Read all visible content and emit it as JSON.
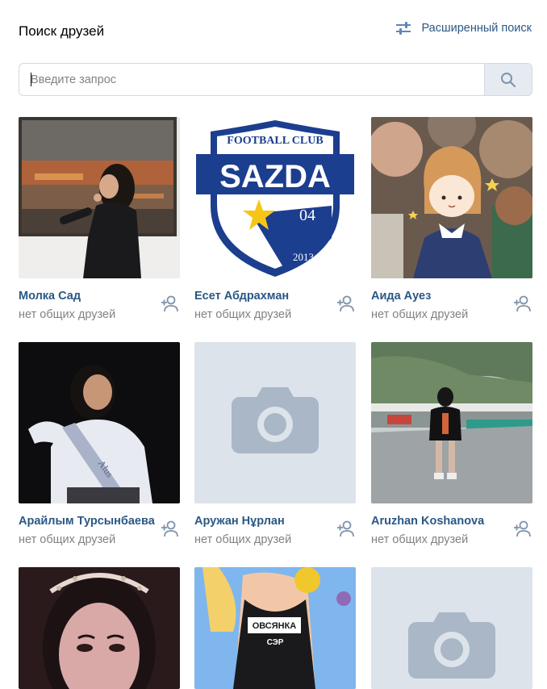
{
  "header": {
    "title": "Поиск друзей",
    "advanced_label": "Расширенный поиск"
  },
  "search": {
    "placeholder": "Введите запрос"
  },
  "people": [
    {
      "name": "Молка Сад",
      "mutual": "нет общих друзей",
      "photo": "girl-gallery-photo"
    },
    {
      "name": "Есет Абдрахман",
      "mutual": "нет общих друзей",
      "photo": "sazda-fc-logo"
    },
    {
      "name": "Аида Ауез",
      "mutual": "нет общих друзей",
      "photo": "cartoon-girl-illustration"
    },
    {
      "name": "Арайлым Турсынбаева",
      "mutual": "нет общих друзей",
      "photo": "girl-graduation-sash-photo"
    },
    {
      "name": "Аружан Нұрлан",
      "mutual": "нет общих друзей",
      "photo": "camera-placeholder-icon"
    },
    {
      "name": "Aruzhan Koshanova",
      "mutual": "нет общих друзей",
      "photo": "girl-walking-road-photo"
    },
    {
      "name": "",
      "mutual": "",
      "photo": "girl-selfie-photo"
    },
    {
      "name": "",
      "mutual": "",
      "photo": "cartoon-swimsuit-illustration"
    },
    {
      "name": "",
      "mutual": "",
      "photo": "camera-placeholder-icon"
    }
  ],
  "logo_text": {
    "top": "FOOTBALL CLUB",
    "name": "SAZDA",
    "number": "04",
    "year": "2013"
  },
  "swimsuit_text": {
    "line1": "ОВСЯНКА",
    "line2": "СЭР"
  },
  "colors": {
    "link": "#2a5885",
    "muted": "#828282",
    "placeholder_bg": "#dde3ea",
    "search_btn_bg": "#e5ebf1",
    "border": "#d3d9de"
  }
}
